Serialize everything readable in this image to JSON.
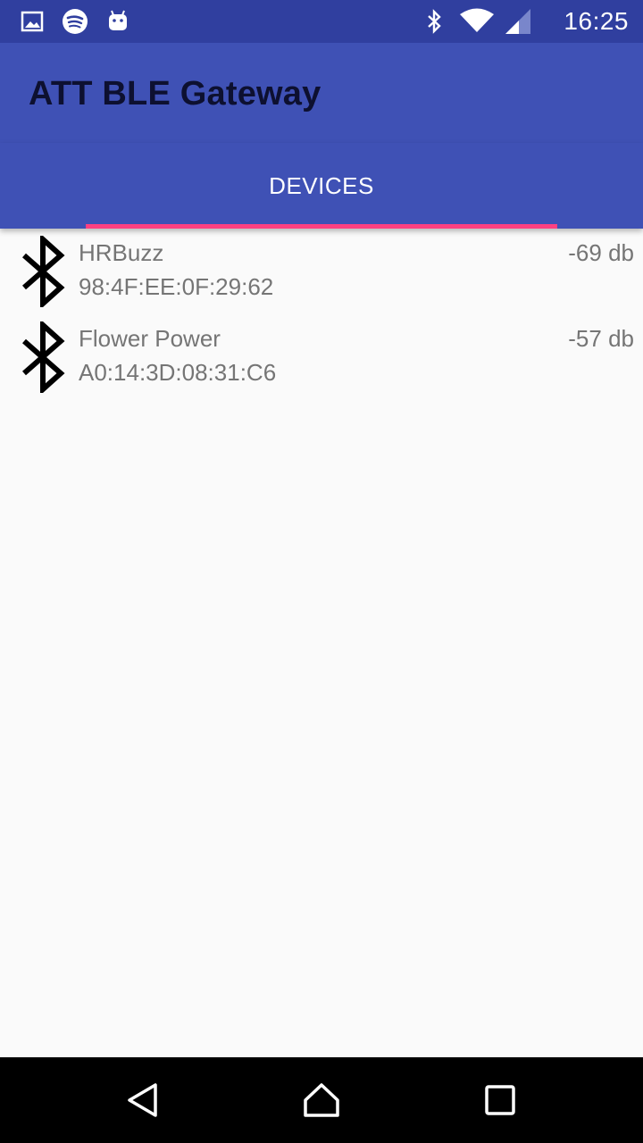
{
  "status_bar": {
    "time": "16:25",
    "icons": [
      "image-icon",
      "spotify-icon",
      "android-icon",
      "bluetooth-icon",
      "wifi-icon",
      "signal-icon"
    ]
  },
  "app": {
    "title": "ATT BLE Gateway"
  },
  "tabs": [
    {
      "label": "DEVICES",
      "selected": true
    }
  ],
  "devices": [
    {
      "name": "HRBuzz",
      "mac": "98:4F:EE:0F:29:62",
      "rssi": "-69 db"
    },
    {
      "name": "Flower Power",
      "mac": "A0:14:3D:08:31:C6",
      "rssi": "-57 db"
    }
  ],
  "nav": {
    "icons": [
      "back-icon",
      "home-icon",
      "recents-icon"
    ]
  },
  "colors": {
    "status_bar": "#303f9f",
    "primary": "#3f51b5",
    "accent": "#ff4081",
    "text_secondary": "#757575"
  }
}
